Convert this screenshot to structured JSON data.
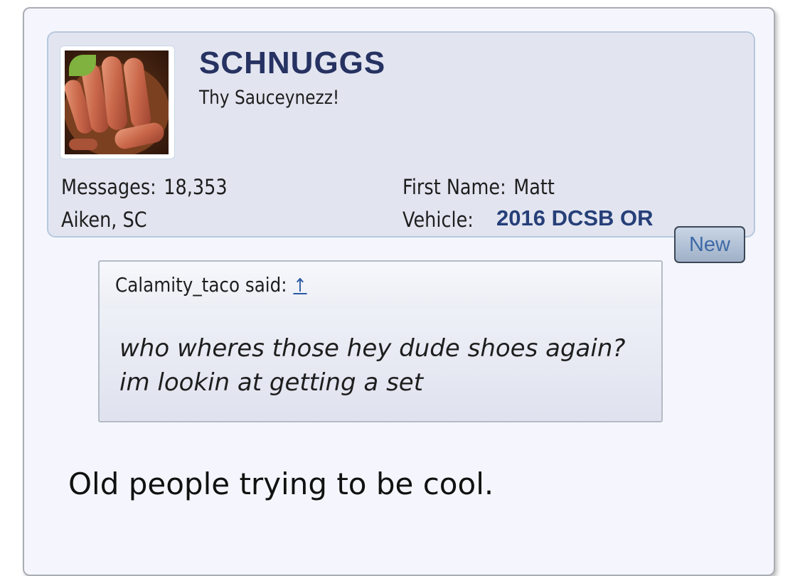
{
  "user": {
    "username": "SCHNUGGS",
    "title": "Thy Sauceynezz!",
    "avatar_icon": "food-avatar",
    "online_status_color": "#7fb23e",
    "messages_label": "Messages:",
    "messages_value": "18,353",
    "location": "Aiken, SC",
    "first_name_label": "First Name:",
    "first_name_value": "Matt",
    "vehicle_label": "Vehicle:",
    "vehicle_value": "2016 DCSB OR"
  },
  "post": {
    "new_badge": "New",
    "quote": {
      "author_label": "Calamity_taco said:",
      "jump_icon": "↑",
      "text": "who wheres those hey dude shoes again? im lookin at getting a set"
    },
    "message": "Old people trying to be cool."
  }
}
